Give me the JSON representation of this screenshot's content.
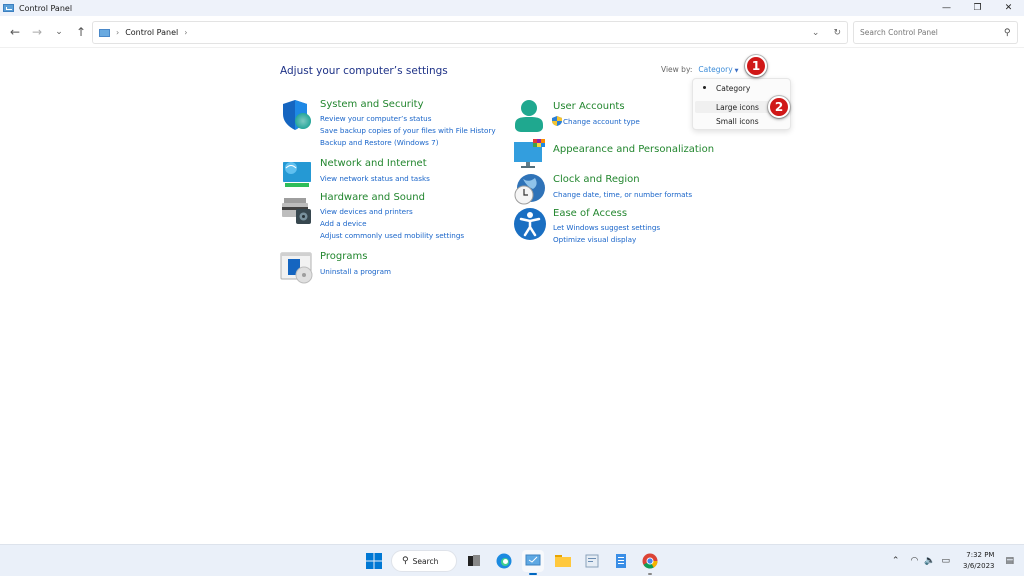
{
  "window": {
    "title": "Control Panel",
    "controls": {
      "minimize": "—",
      "maximize": "❐",
      "close": "✕"
    }
  },
  "navbar": {
    "back": "←",
    "forward": "→",
    "recent": "⌄",
    "up": "↑",
    "breadcrumb": [
      "Control Panel"
    ],
    "sep": "›",
    "dropdown": "⌄",
    "refresh": "↻",
    "search_placeholder": "Search Control Panel"
  },
  "main": {
    "heading": "Adjust your computer’s settings",
    "view_by": {
      "label": "View by:",
      "value": "Category",
      "options": [
        "Category",
        "Large icons",
        "Small icons"
      ],
      "selected": "Category",
      "hovered": "Large icons"
    },
    "badges": [
      "1",
      "2"
    ],
    "left_column": [
      {
        "title": "System and Security",
        "icon": "shield-icon",
        "links": [
          "Review your computer’s status",
          "Save backup copies of your files with File History",
          "Backup and Restore (Windows 7)"
        ]
      },
      {
        "title": "Network and Internet",
        "icon": "network-icon",
        "links": [
          "View network status and tasks"
        ]
      },
      {
        "title": "Hardware and Sound",
        "icon": "printer-icon",
        "links": [
          "View devices and printers",
          "Add a device",
          "Adjust commonly used mobility settings"
        ]
      },
      {
        "title": "Programs",
        "icon": "programs-icon",
        "links": [
          "Uninstall a program"
        ]
      }
    ],
    "right_column": [
      {
        "title": "User Accounts",
        "icon": "user-icon",
        "links": [
          "Change account type"
        ]
      },
      {
        "title": "Appearance and Personalization",
        "icon": "monitor-icon",
        "links": []
      },
      {
        "title": "Clock and Region",
        "icon": "clock-globe-icon",
        "links": [
          "Change date, time, or number formats"
        ]
      },
      {
        "title": "Ease of Access",
        "icon": "accessibility-icon",
        "links": [
          "Let Windows suggest settings",
          "Optimize visual display"
        ]
      }
    ]
  },
  "taskbar": {
    "search_label": "Search",
    "time": "7:32 PM",
    "date": "3/6/2023",
    "colors": {
      "accent": "#0067c0"
    }
  },
  "colors": {
    "category_title": "#22862e",
    "link": "#1a65c9",
    "heading": "#1e3287",
    "badge": "#d01818"
  }
}
